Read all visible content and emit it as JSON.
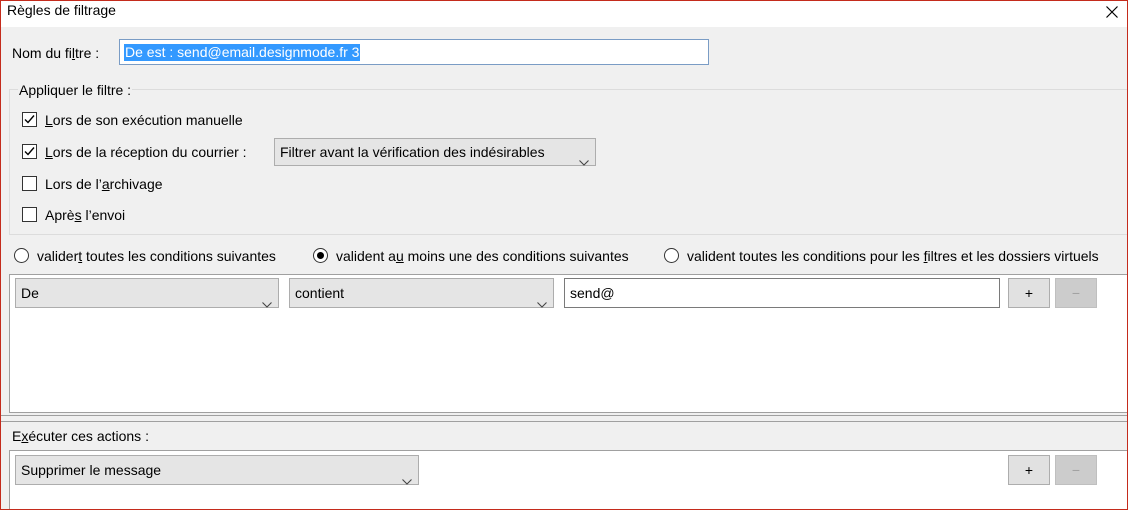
{
  "window": {
    "title": "Règles de filtrage"
  },
  "filter_name": {
    "label_before": "Nom du fi",
    "label_access": "l",
    "label_after": "tre :",
    "value": "De est : send@email.designmode.fr 3"
  },
  "apply": {
    "legend": "Appliquer le filtre :",
    "options": [
      {
        "pre": "",
        "key": "L",
        "post": "ors de son exécution manuelle",
        "checked": true
      },
      {
        "pre": "",
        "key": "L",
        "post": "ors de la réception du courrier :",
        "checked": true
      },
      {
        "pre": "Lors de l’",
        "key": "a",
        "post": "rchivage",
        "checked": false
      },
      {
        "pre": "Aprè",
        "key": "s",
        "post": " l’envoi",
        "checked": false
      }
    ],
    "timing_select": "Filtrer avant la vérification des indésirables"
  },
  "match": {
    "options": [
      {
        "pre": "valider",
        "key": "t",
        "post": " toutes les conditions suivantes",
        "selected": false
      },
      {
        "pre": "valident a",
        "key": "u",
        "post": " moins une des conditions suivantes",
        "selected": true
      },
      {
        "pre": "valident toutes les conditions pour les ",
        "key": "f",
        "post": "iltres et les dossiers virtuels",
        "selected": false
      }
    ]
  },
  "conditions": [
    {
      "field": "De",
      "operator": "contient",
      "value": "send@",
      "add_label": "+",
      "remove_label": "−"
    }
  ],
  "actions": {
    "label_pre": "E",
    "label_key": "x",
    "label_post": "écuter ces actions :",
    "items": [
      {
        "action": "Supprimer le message",
        "add_label": "+",
        "remove_label": "−"
      }
    ]
  }
}
